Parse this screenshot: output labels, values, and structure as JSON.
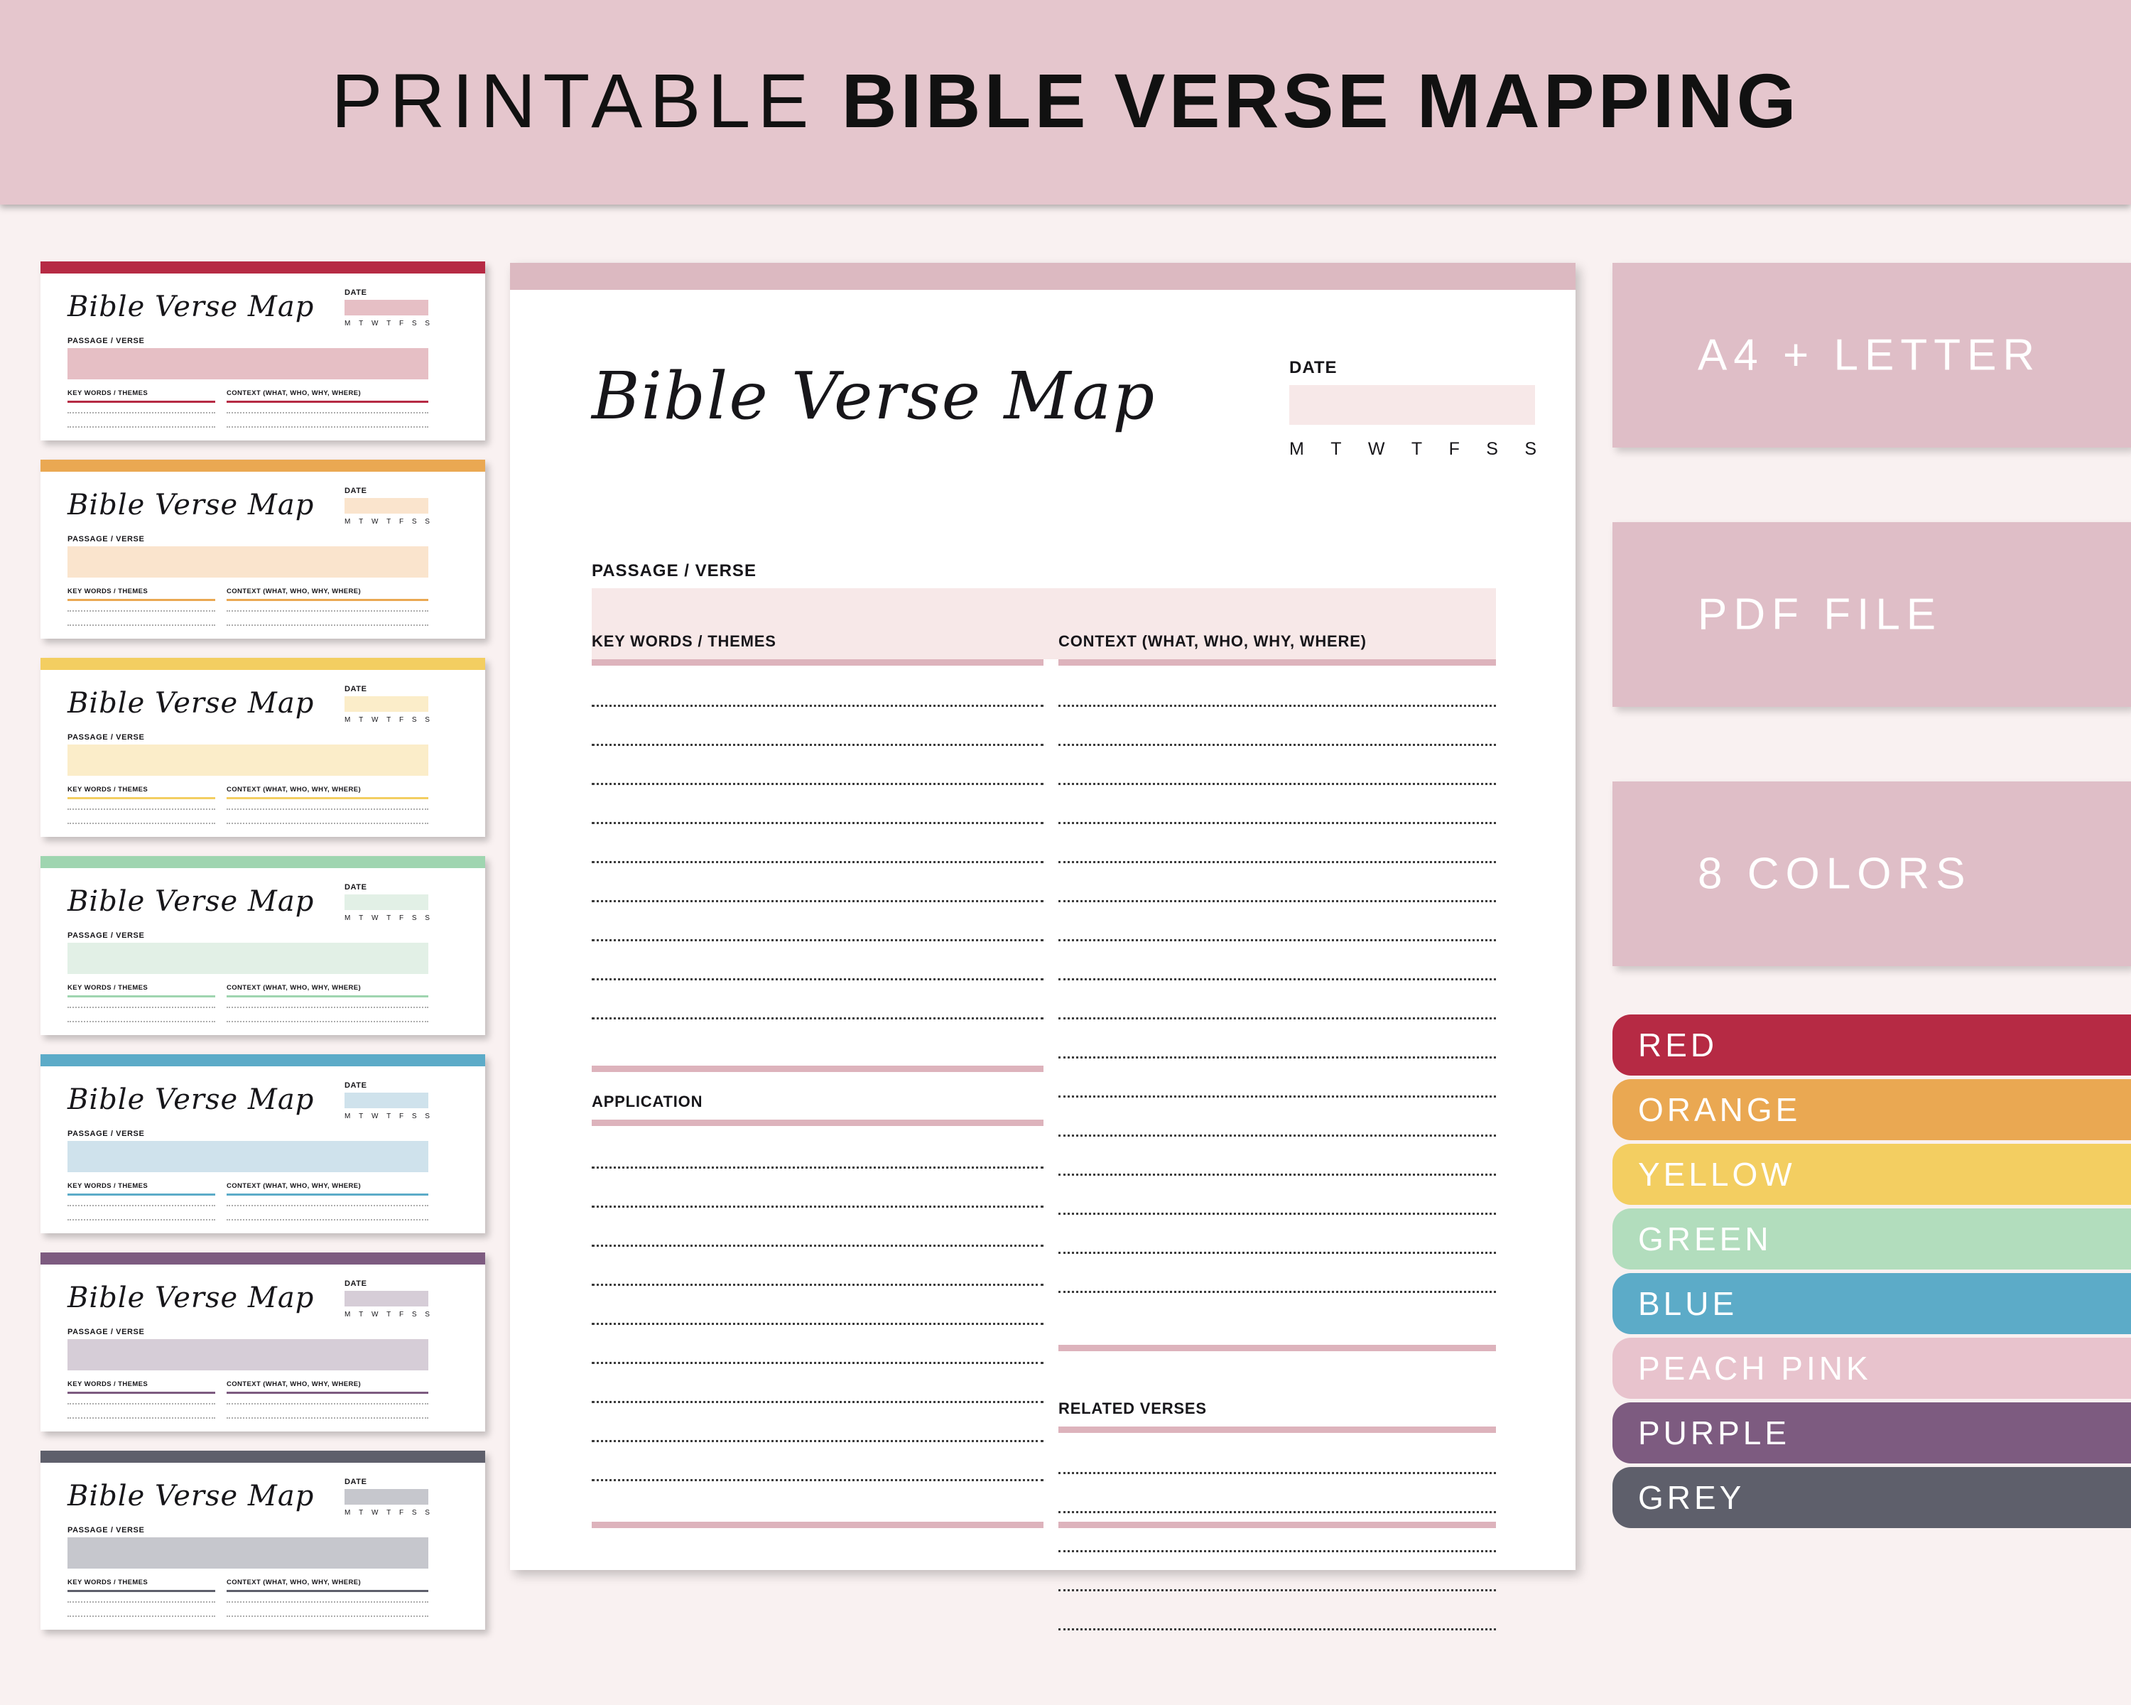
{
  "banner": {
    "title_light": "PRINTABLE",
    "title_bold": "BIBLE VERSE MAPPING"
  },
  "colors": {
    "banner_bg": "#e5c6cd",
    "page_bg": "#f9f1f1",
    "accent_pink": "#ddb3bc",
    "pale_pink": "#f7e8e8",
    "badge_bg": "#dfbec7"
  },
  "main_page": {
    "title": "Bible Verse Map",
    "date_label": "DATE",
    "days": [
      "M",
      "T",
      "W",
      "T",
      "F",
      "S",
      "S"
    ],
    "passage_label": "PASSAGE / VERSE",
    "keywords_label": "KEY WORDS / THEMES",
    "context_label": "CONTEXT (WHAT, WHO, WHY, WHERE)",
    "application_label": "APPLICATION",
    "related_verses_label": "RELATED VERSES"
  },
  "badges": [
    {
      "label": "A4 + LETTER"
    },
    {
      "label": "PDF FILE"
    },
    {
      "label": "8 COLORS"
    }
  ],
  "swatches": [
    {
      "label": "RED",
      "hex": "#b62a44"
    },
    {
      "label": "ORANGE",
      "hex": "#eaa852"
    },
    {
      "label": "YELLOW",
      "hex": "#f3ce61"
    },
    {
      "label": "GREEN",
      "hex": "#b2ddbd"
    },
    {
      "label": "BLUE",
      "hex": "#5cabc8"
    },
    {
      "label": "PEACH PINK",
      "hex": "#e8c3cd"
    },
    {
      "label": "PURPLE",
      "hex": "#7d5b80"
    },
    {
      "label": "GREY",
      "hex": "#5e5f6b"
    }
  ],
  "thumbnails": [
    {
      "name": "red",
      "bar": "#b62a44",
      "fill": "#e6bfc5",
      "rule": "#b62a44"
    },
    {
      "name": "orange",
      "bar": "#eaa852",
      "fill": "#fae4cd",
      "rule": "#eaa852"
    },
    {
      "name": "yellow",
      "bar": "#f3ce61",
      "fill": "#fbedc9",
      "rule": "#f3ce61"
    },
    {
      "name": "green",
      "bar": "#9fd5b0",
      "fill": "#e2f0e6",
      "rule": "#9fd5b0"
    },
    {
      "name": "blue",
      "bar": "#5cabc8",
      "fill": "#cfe2ec",
      "rule": "#5cabc8"
    },
    {
      "name": "purple",
      "bar": "#7d5b80",
      "fill": "#d6cdd7",
      "rule": "#7d5b80"
    },
    {
      "name": "grey",
      "bar": "#5e5f6b",
      "fill": "#c6c7cd",
      "rule": "#5e5f6b"
    }
  ],
  "thumbnail_text": {
    "title": "Bible Verse Map",
    "date_label": "DATE",
    "passage_label": "PASSAGE / VERSE",
    "keywords_label": "KEY WORDS / THEMES",
    "context_label": "CONTEXT (WHAT, WHO, WHY, WHERE)",
    "days": [
      "M",
      "T",
      "W",
      "T",
      "F",
      "S",
      "S"
    ]
  }
}
